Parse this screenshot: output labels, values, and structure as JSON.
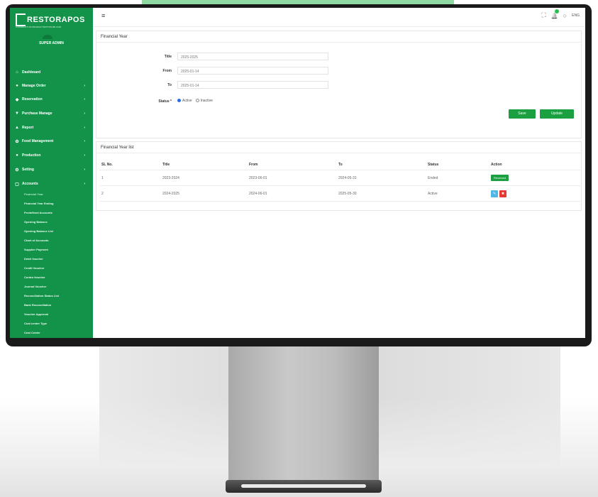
{
  "app": {
    "logo": "RESTORAPOS",
    "tagline": "A PRODUCT OF PRODUCT BUTTON BD.COM",
    "role": "SUPER ADMIN"
  },
  "colors": {
    "sidebar": "#13934a",
    "accent_button": "#1aa040",
    "edit_button": "#4fb8e6",
    "delete_button": "#e53935"
  },
  "sidebar": {
    "items": [
      {
        "label": "Dashboard",
        "icon": "home-icon",
        "glyph": "⌂",
        "arrow": ""
      },
      {
        "label": "Manage Order",
        "icon": "order-icon",
        "glyph": "●",
        "arrow": "›"
      },
      {
        "label": "Reservation",
        "icon": "reservation-icon",
        "glyph": "◆",
        "arrow": "›"
      },
      {
        "label": "Purchase Manage",
        "icon": "cart-icon",
        "glyph": "▼",
        "arrow": "›"
      },
      {
        "label": "Report",
        "icon": "chart-icon",
        "glyph": "▲",
        "arrow": "›"
      },
      {
        "label": "Food Management",
        "icon": "food-icon",
        "glyph": "✿",
        "arrow": "›"
      },
      {
        "label": "Production",
        "icon": "production-icon",
        "glyph": "●",
        "arrow": "›"
      },
      {
        "label": "Setting",
        "icon": "gear-icon",
        "glyph": "⚙",
        "arrow": "›"
      },
      {
        "label": "Accounts",
        "icon": "accounts-icon",
        "glyph": "▢",
        "arrow": "›"
      }
    ],
    "subitems": [
      "Financial Year",
      "Financial Year Ending",
      "Predefined Accounts",
      "Opening Balance",
      "Opening Balance List",
      "Chart of Accounts",
      "Supplier Payment",
      "Debit Voucher",
      "Credit Voucher",
      "Contra Voucher",
      "Journal Voucher",
      "Reconciliation Status List",
      "Bank Reconciliation",
      "Voucher Approval",
      "Cost center Type",
      "Cost Center"
    ]
  },
  "topbar": {
    "menu_icon": "≡",
    "expand_icon": "⛶",
    "bell_icon": "🔔",
    "user_icon": "○",
    "lang": "ENG"
  },
  "form": {
    "heading": "Financial Year",
    "title_label": "Title",
    "title_value": "2025-2025",
    "from_label": "From",
    "from_value": "2025-01-14",
    "to_label": "To",
    "to_value": "2025-01-14",
    "status_label": "Status *",
    "status_active": "Active",
    "status_inactive": "Inactive",
    "save_label": "Save",
    "update_label": "Update"
  },
  "list": {
    "heading": "Financial Year list",
    "columns": [
      "SL No.",
      "Title",
      "From",
      "To",
      "Status",
      "Action"
    ],
    "rows": [
      {
        "sl": "1",
        "title": "2023-2024",
        "from": "2023-06-01",
        "to": "2024-05-31",
        "status": "Ended",
        "action": "Reversed"
      },
      {
        "sl": "2",
        "title": "2024-2025",
        "from": "2024-06-01",
        "to": "2025-05-30",
        "status": "Active",
        "edit": "✎",
        "delete": "✖"
      }
    ]
  }
}
